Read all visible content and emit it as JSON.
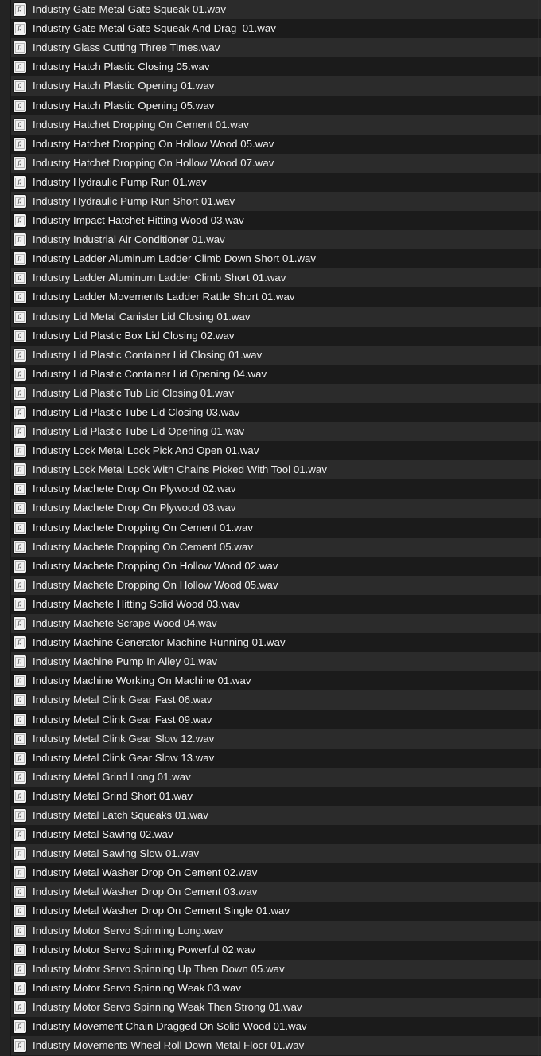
{
  "window": {
    "title": "Sound Library File List",
    "background_color": "#1c1c1c",
    "row_color_odd": "#2b2b2b",
    "row_color_even": "#1b1b1b",
    "text_color": "#f0f0f0",
    "icon_color": "#f2f2f2"
  },
  "file_list": {
    "icon_name": "music-note-file-icon",
    "row_count": 55,
    "items": [
      {
        "name": "Industry Gate Metal Gate Squeak 01.wav"
      },
      {
        "name": "Industry Gate Metal Gate Squeak And Drag  01.wav"
      },
      {
        "name": "Industry Glass Cutting Three Times.wav"
      },
      {
        "name": "Industry Hatch Plastic Closing 05.wav"
      },
      {
        "name": "Industry Hatch Plastic Opening 01.wav"
      },
      {
        "name": "Industry Hatch Plastic Opening 05.wav"
      },
      {
        "name": "Industry Hatchet Dropping On Cement 01.wav"
      },
      {
        "name": "Industry Hatchet Dropping On Hollow Wood 05.wav"
      },
      {
        "name": "Industry Hatchet Dropping On Hollow Wood 07.wav"
      },
      {
        "name": "Industry Hydraulic Pump Run 01.wav"
      },
      {
        "name": "Industry Hydraulic Pump Run Short 01.wav"
      },
      {
        "name": "Industry Impact Hatchet Hitting Wood 03.wav"
      },
      {
        "name": "Industry Industrial Air Conditioner 01.wav"
      },
      {
        "name": "Industry Ladder Aluminum Ladder Climb Down Short 01.wav"
      },
      {
        "name": "Industry Ladder Aluminum Ladder Climb Short 01.wav"
      },
      {
        "name": "Industry Ladder Movements Ladder Rattle Short 01.wav"
      },
      {
        "name": "Industry Lid Metal Canister Lid Closing 01.wav"
      },
      {
        "name": "Industry Lid Plastic Box Lid Closing 02.wav"
      },
      {
        "name": "Industry Lid Plastic Container Lid Closing 01.wav"
      },
      {
        "name": "Industry Lid Plastic Container Lid Opening 04.wav"
      },
      {
        "name": "Industry Lid Plastic Tub Lid Closing 01.wav"
      },
      {
        "name": "Industry Lid Plastic Tube Lid Closing 03.wav"
      },
      {
        "name": "Industry Lid Plastic Tube Lid Opening 01.wav"
      },
      {
        "name": "Industry Lock Metal Lock Pick And Open 01.wav"
      },
      {
        "name": "Industry Lock Metal Lock With Chains Picked With Tool 01.wav"
      },
      {
        "name": "Industry Machete Drop On Plywood 02.wav"
      },
      {
        "name": "Industry Machete Drop On Plywood 03.wav"
      },
      {
        "name": "Industry Machete Dropping On Cement 01.wav"
      },
      {
        "name": "Industry Machete Dropping On Cement 05.wav"
      },
      {
        "name": "Industry Machete Dropping On Hollow Wood 02.wav"
      },
      {
        "name": "Industry Machete Dropping On Hollow Wood 05.wav"
      },
      {
        "name": "Industry Machete Hitting Solid Wood 03.wav"
      },
      {
        "name": "Industry Machete Scrape Wood 04.wav"
      },
      {
        "name": "Industry Machine Generator Machine Running 01.wav"
      },
      {
        "name": "Industry Machine Pump In Alley 01.wav"
      },
      {
        "name": "Industry Machine Working On Machine 01.wav"
      },
      {
        "name": "Industry Metal Clink Gear Fast 06.wav"
      },
      {
        "name": "Industry Metal Clink Gear Fast 09.wav"
      },
      {
        "name": "Industry Metal Clink Gear Slow 12.wav"
      },
      {
        "name": "Industry Metal Clink Gear Slow 13.wav"
      },
      {
        "name": "Industry Metal Grind Long 01.wav"
      },
      {
        "name": "Industry Metal Grind Short 01.wav"
      },
      {
        "name": "Industry Metal Latch Squeaks 01.wav"
      },
      {
        "name": "Industry Metal Sawing 02.wav"
      },
      {
        "name": "Industry Metal Sawing Slow 01.wav"
      },
      {
        "name": "Industry Metal Washer Drop On Cement 02.wav"
      },
      {
        "name": "Industry Metal Washer Drop On Cement 03.wav"
      },
      {
        "name": "Industry Metal Washer Drop On Cement Single 01.wav"
      },
      {
        "name": "Industry Motor Servo Spinning Long.wav"
      },
      {
        "name": "Industry Motor Servo Spinning Powerful 02.wav"
      },
      {
        "name": "Industry Motor Servo Spinning Up Then Down 05.wav"
      },
      {
        "name": "Industry Motor Servo Spinning Weak 03.wav"
      },
      {
        "name": "Industry Motor Servo Spinning Weak Then Strong 01.wav"
      },
      {
        "name": "Industry Movement Chain Dragged On Solid Wood 01.wav"
      },
      {
        "name": "Industry Movements Wheel Roll Down Metal Floor 01.wav"
      }
    ]
  }
}
